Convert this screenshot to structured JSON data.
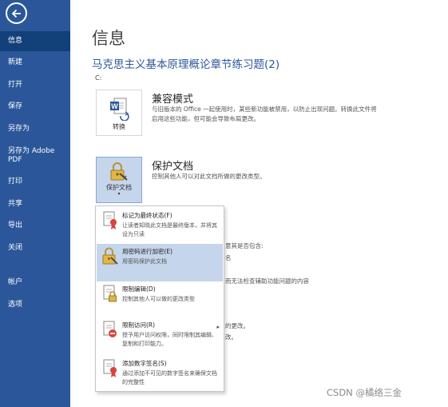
{
  "sidebar": {
    "items": [
      {
        "label": "信息"
      },
      {
        "label": "新建"
      },
      {
        "label": "打开"
      },
      {
        "label": "保存"
      },
      {
        "label": "另存为"
      },
      {
        "label": "另存为 Adobe PDF"
      },
      {
        "label": "打印"
      },
      {
        "label": "共享"
      },
      {
        "label": "导出"
      },
      {
        "label": "关闭"
      },
      {
        "label": "帐户"
      },
      {
        "label": "选项"
      }
    ]
  },
  "main": {
    "page_title": "信息",
    "doc_title": "马克思主义基本原理概论章节练习题(2)",
    "doc_path": "C:",
    "compat": {
      "tile_label": "转换",
      "title": "兼容模式",
      "desc_1": "与旧版本的 Office 一起使用时，某些新功能被禁用，以防止出现问题。转换此文件将",
      "desc_2": "启用这些功能，但可能会导致布局更改。"
    },
    "protect": {
      "tile_label": "保护文档",
      "title": "保护文档",
      "desc": "控制其他人可以对此文档所做的更改类型。"
    },
    "bg_snippets": [
      "意其是否包含:",
      "名",
      "而无法检查辅助功能问题的内容",
      "的更改。",
      "改。"
    ]
  },
  "menu": {
    "items": [
      {
        "title": "标记为最终状态(F)",
        "desc": "让读者知晓此文档是最终版本，并将其设为只读"
      },
      {
        "title": "用密码进行加密(E)",
        "desc": "用密码保护此文档"
      },
      {
        "title": "限制编辑(D)",
        "desc": "控制其他人可以做的更改类型"
      },
      {
        "title": "限制访问(R)",
        "desc": "授予用户访问权限，同时限制其编辑、复制和打印能力。",
        "arrow": "▸"
      },
      {
        "title": "添加数字签名(S)",
        "desc": "通过添加不可见的数字签名来确保文档的完整性"
      }
    ]
  },
  "watermark": "CSDN @橘络三金",
  "colors": {
    "sidebar": "#2b579a",
    "sidebar_active": "#124078",
    "accent": "#2b579a",
    "highlight": "#c5d5ec"
  }
}
